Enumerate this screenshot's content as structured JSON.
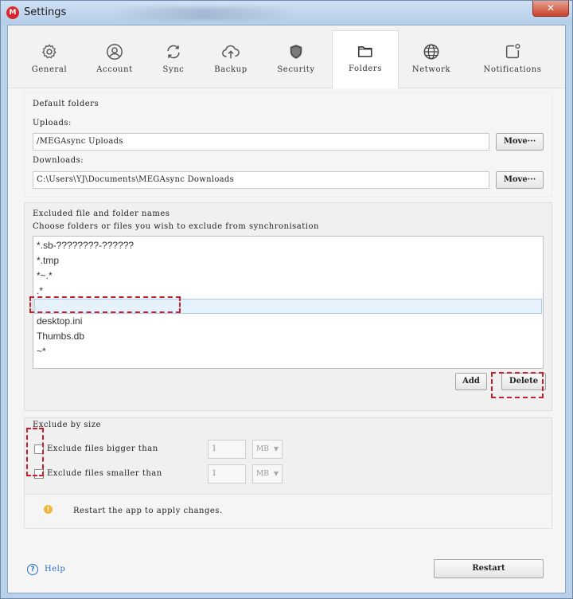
{
  "window": {
    "title": "Settings",
    "logo_letter": "M",
    "close_glyph": "✕",
    "colors": {
      "accent_red": "#d9272e",
      "highlight_dash": "#c8202d",
      "selection": "#e5f1fb"
    }
  },
  "tabs": [
    {
      "label": "General",
      "icon": "gear-icon"
    },
    {
      "label": "Account",
      "icon": "account-icon"
    },
    {
      "label": "Sync",
      "icon": "sync-icon"
    },
    {
      "label": "Backup",
      "icon": "cloud-upload-icon"
    },
    {
      "label": "Security",
      "icon": "shield-icon"
    },
    {
      "label": "Folders",
      "icon": "folder-icon",
      "active": true
    },
    {
      "label": "Network",
      "icon": "globe-icon"
    },
    {
      "label": "Notifications",
      "icon": "notification-icon"
    }
  ],
  "default_folders": {
    "heading": "Default folders",
    "uploads_label": "Uploads:",
    "uploads_value": "/MEGAsync Uploads",
    "downloads_label": "Downloads:",
    "downloads_value": "C:\\Users\\YJ\\Documents\\MEGAsync Downloads",
    "move_label": "Move···"
  },
  "excluded": {
    "heading": "Excluded file and folder names",
    "description": "Choose folders or files you wish to exclude from synchronisation",
    "items": [
      "*.sb-????????-??????",
      "*.tmp",
      "*~.*",
      ".*",
      "",
      "desktop.ini",
      "Thumbs.db",
      "~*"
    ],
    "selected_index": 4,
    "add_label": "Add",
    "delete_label": "Delete"
  },
  "size_limits": {
    "heading": "Exclude by size",
    "bigger_label": "Exclude files bigger than",
    "smaller_label": "Exclude files smaller than",
    "bigger_value": "1",
    "smaller_value": "1",
    "unit": "MB"
  },
  "notice": {
    "text": "Restart the app to apply changes.",
    "icon_glyph": "!"
  },
  "footer": {
    "help_label": "Help",
    "help_glyph": "?",
    "restart_label": "Restart"
  }
}
